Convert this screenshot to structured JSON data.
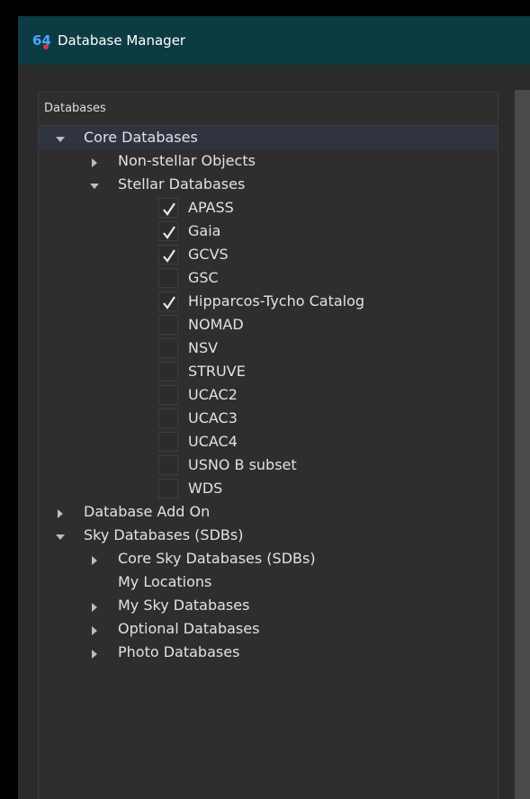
{
  "window": {
    "title": "Database Manager",
    "app_icon": "64"
  },
  "panel": {
    "title": "Databases"
  },
  "tree": [
    {
      "label": "Core Databases",
      "level": 0,
      "expander": "expanded",
      "selected": true
    },
    {
      "label": "Non-stellar Objects",
      "level": 1,
      "expander": "collapsed"
    },
    {
      "label": "Stellar Databases",
      "level": 1,
      "expander": "expanded"
    },
    {
      "label": "APASS",
      "level": 2,
      "checkbox": true,
      "checked": true
    },
    {
      "label": "Gaia",
      "level": 2,
      "checkbox": true,
      "checked": true
    },
    {
      "label": "GCVS",
      "level": 2,
      "checkbox": true,
      "checked": true
    },
    {
      "label": "GSC",
      "level": 2,
      "checkbox": true,
      "checked": false
    },
    {
      "label": "Hipparcos-Tycho Catalog",
      "level": 2,
      "checkbox": true,
      "checked": true
    },
    {
      "label": "NOMAD",
      "level": 2,
      "checkbox": true,
      "checked": false
    },
    {
      "label": "NSV",
      "level": 2,
      "checkbox": true,
      "checked": false
    },
    {
      "label": "STRUVE",
      "level": 2,
      "checkbox": true,
      "checked": false
    },
    {
      "label": "UCAC2",
      "level": 2,
      "checkbox": true,
      "checked": false
    },
    {
      "label": "UCAC3",
      "level": 2,
      "checkbox": true,
      "checked": false
    },
    {
      "label": "UCAC4",
      "level": 2,
      "checkbox": true,
      "checked": false
    },
    {
      "label": "USNO B subset",
      "level": 2,
      "checkbox": true,
      "checked": false
    },
    {
      "label": "WDS",
      "level": 2,
      "checkbox": true,
      "checked": false
    },
    {
      "label": "Database Add On",
      "level": 0,
      "expander": "collapsed"
    },
    {
      "label": "Sky Databases (SDBs)",
      "level": 0,
      "expander": "expanded"
    },
    {
      "label": "Core Sky Databases (SDBs)",
      "level": 1,
      "expander": "collapsed"
    },
    {
      "label": "My Locations",
      "level": 1,
      "expander": "none"
    },
    {
      "label": "My Sky Databases",
      "level": 1,
      "expander": "collapsed"
    },
    {
      "label": "Optional Databases",
      "level": 1,
      "expander": "collapsed"
    },
    {
      "label": "Photo Databases",
      "level": 1,
      "expander": "collapsed"
    }
  ],
  "colors": {
    "titlebar": "#0d3b44",
    "background": "#2b2b2b",
    "text": "#e2e2e2",
    "selection": "#2f3440"
  }
}
